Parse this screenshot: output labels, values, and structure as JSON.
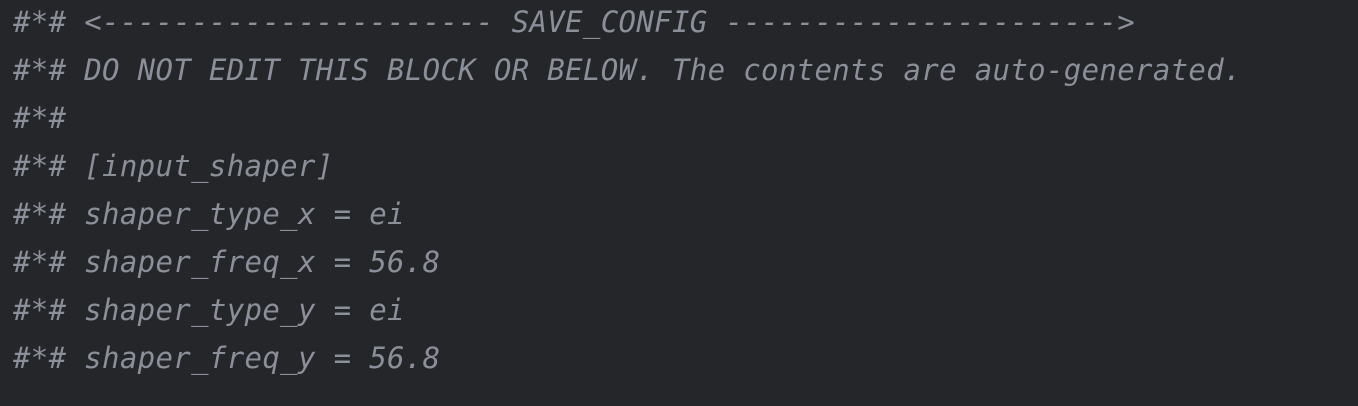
{
  "editor": {
    "background": "#25262a",
    "comment_color": "#8a8f99",
    "comment_marker": "#*#",
    "lines": [
      "<---------------------- SAVE_CONFIG ---------------------->",
      "DO NOT EDIT THIS BLOCK OR BELOW. The contents are auto-generated.",
      "",
      "[input_shaper]",
      "shaper_type_x = ei",
      "shaper_freq_x = 56.8",
      "shaper_type_y = ei",
      "shaper_freq_y = 56.8"
    ]
  }
}
